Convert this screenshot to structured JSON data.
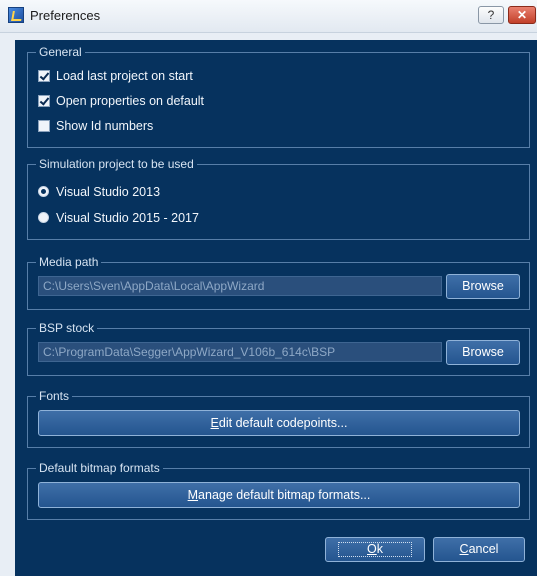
{
  "window": {
    "title": "Preferences",
    "help_label": "?",
    "close_label": "✕"
  },
  "general": {
    "legend": "General",
    "options": [
      {
        "label": "Load last project on start",
        "checked": true
      },
      {
        "label": "Open properties on default",
        "checked": true
      },
      {
        "label": "Show Id numbers",
        "checked": false
      }
    ]
  },
  "simulation": {
    "legend": "Simulation project to be used",
    "options": [
      {
        "label": "Visual Studio 2013",
        "selected": true
      },
      {
        "label": "Visual Studio 2015 - 2017",
        "selected": false
      }
    ]
  },
  "media_path": {
    "legend": "Media path",
    "value": "C:\\Users\\Sven\\AppData\\Local\\AppWizard",
    "browse_label": "Browse"
  },
  "bsp_stock": {
    "legend": "BSP stock",
    "value": "C:\\ProgramData\\Segger\\AppWizard_V106b_614c\\BSP",
    "browse_label": "Browse"
  },
  "fonts": {
    "legend": "Fonts",
    "button_mnemonic": "E",
    "button_rest": "dit default codepoints..."
  },
  "bitmap": {
    "legend": "Default bitmap formats",
    "button_mnemonic": "M",
    "button_rest": "anage default bitmap formats..."
  },
  "footer": {
    "ok_mnemonic": "O",
    "ok_rest": "k",
    "cancel_mnemonic": "C",
    "cancel_rest": "ancel"
  },
  "colors": {
    "dialog_bg": "#06325e",
    "button_bg": "#2f619c",
    "field_bg": "#2a4f7c",
    "group_border": "#577ea8"
  }
}
